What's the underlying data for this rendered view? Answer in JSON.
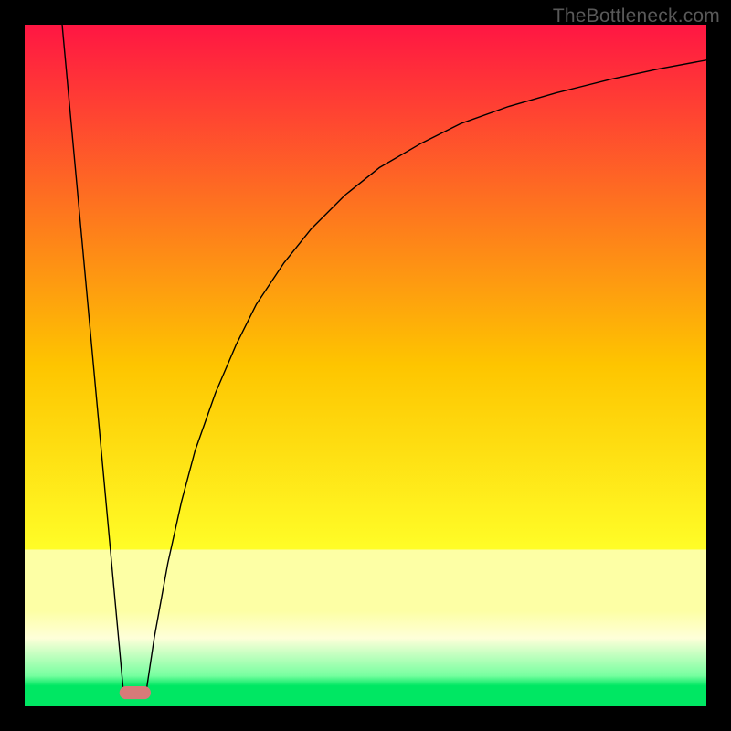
{
  "watermark": "TheBottleneck.com",
  "chart_data": {
    "type": "line",
    "title": "",
    "xlabel": "",
    "ylabel": "",
    "xlim": [
      0,
      100
    ],
    "ylim": [
      0,
      100
    ],
    "grid": false,
    "legend": false,
    "background_gradient_stops": [
      {
        "pos": 0.0,
        "color": "#ff1643"
      },
      {
        "pos": 0.5,
        "color": "#fec500"
      },
      {
        "pos": 0.77,
        "color": "#fffd27"
      },
      {
        "pos": 0.77,
        "color": "#fdffa5"
      },
      {
        "pos": 0.86,
        "color": "#fdffa5"
      },
      {
        "pos": 0.9,
        "color": "#feffd9"
      },
      {
        "pos": 0.955,
        "color": "#77ffa0"
      },
      {
        "pos": 0.97,
        "color": "#00e763"
      },
      {
        "pos": 1.0,
        "color": "#00e763"
      }
    ],
    "series": [
      {
        "name": "left-edge",
        "x": [
          5.5,
          14.5
        ],
        "y": [
          100,
          2
        ],
        "stroke": "#000000",
        "width": 1.4
      },
      {
        "name": "right-curve",
        "x": [
          17.8,
          19,
          21,
          23,
          25,
          28,
          31,
          34,
          38,
          42,
          47,
          52,
          58,
          64,
          71,
          78,
          86,
          93,
          100
        ],
        "y": [
          2,
          10,
          21,
          30,
          37.5,
          46,
          53,
          59,
          65,
          70,
          75,
          79,
          82.5,
          85.5,
          88,
          90,
          92,
          93.5,
          94.8
        ],
        "stroke": "#000000",
        "width": 1.4
      }
    ],
    "marker": {
      "name": "bottom-pill",
      "cx": 16.2,
      "cy": 2.0,
      "w": 4.6,
      "h": 1.9,
      "rx": 0.95,
      "fill": "#d77a79"
    }
  }
}
